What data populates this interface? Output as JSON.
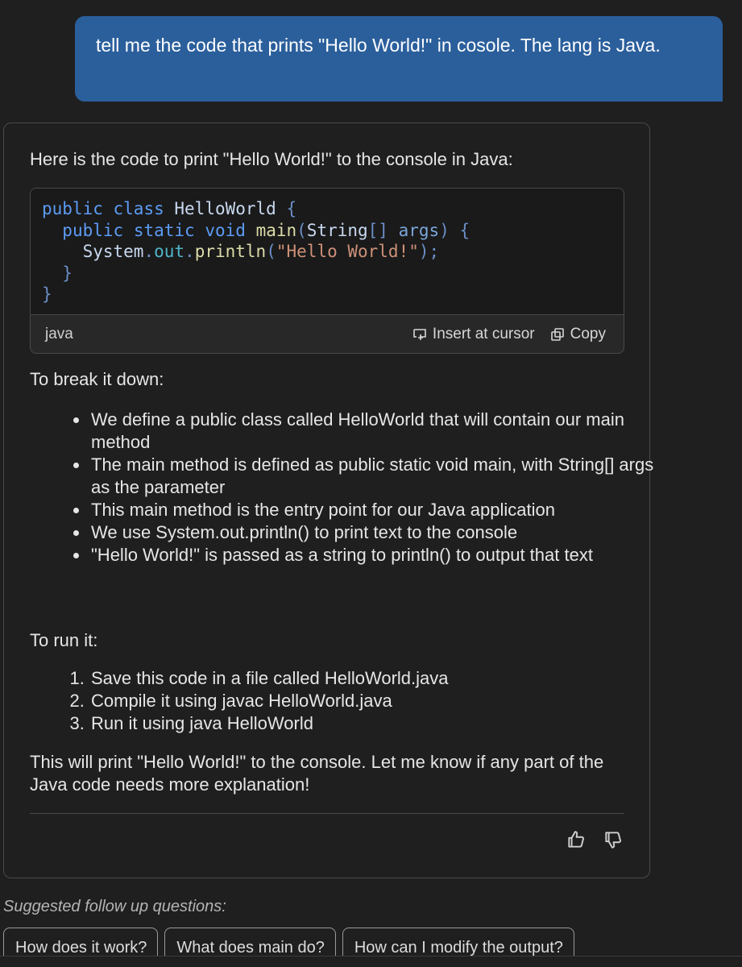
{
  "user_message": "tell me the code that prints \"Hello World!\" in cosole. The lang is Java.",
  "response": {
    "intro": "Here is the code to print \"Hello World!\" to the console in Java:",
    "code_block": {
      "language": "java",
      "insert_label": "Insert at cursor",
      "copy_label": "Copy"
    },
    "breakdown_heading": "To break it down:",
    "breakdown_items": [
      "We define a public class called HelloWorld that will contain our main method",
      "The main method is defined as public static void main, with String[] args as the parameter",
      "This main method is the entry point for our Java application",
      "We use System.out.println() to print text to the console",
      "\"Hello World!\" is passed as a string to println() to output that text"
    ],
    "run_heading": "To run it:",
    "run_steps": [
      "Save this code in a file called HelloWorld.java",
      "Compile it using javac HelloWorld.java",
      "Run it using java HelloWorld"
    ],
    "closing": "This will print \"Hello World!\" to the console. Let me know if any part of the Java code needs more explanation!"
  },
  "suggestions": {
    "label": "Suggested follow up questions:",
    "items": [
      "How does it work?",
      "What does main do?",
      "How can I modify the output?"
    ]
  },
  "colors": {
    "user_bubble": "#2b5f9c",
    "background": "#1f1f1f",
    "border": "#4a4a4a"
  }
}
